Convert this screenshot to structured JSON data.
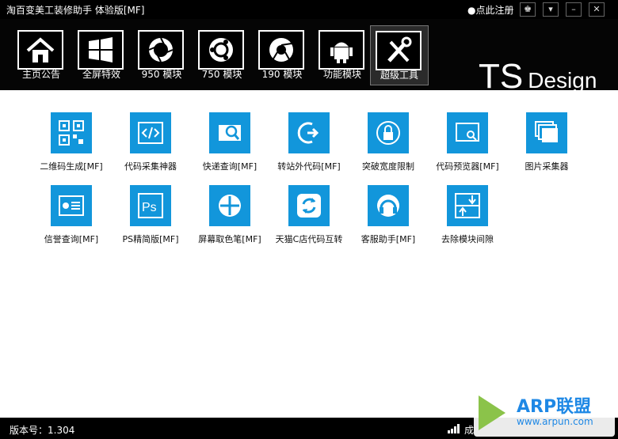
{
  "window": {
    "title": "淘百变美工装修助手  体验版[MF]",
    "register_label": "●点此注册"
  },
  "toolbar": {
    "items": [
      {
        "label": "主页公告",
        "icon": "home-icon"
      },
      {
        "label": "全屏特效",
        "icon": "windows-icon"
      },
      {
        "label": "950 模块",
        "icon": "aperture-icon"
      },
      {
        "label": "750 模块",
        "icon": "ubuntu-icon"
      },
      {
        "label": "190 模块",
        "icon": "chrome-icon"
      },
      {
        "label": "功能模块",
        "icon": "android-icon"
      },
      {
        "label": "超级工具",
        "icon": "tools-icon",
        "active": true
      }
    ]
  },
  "brand": {
    "ts": "TS",
    "design": "Design"
  },
  "tools": [
    {
      "label": "二维码生成[MF]",
      "icon": "qr-code-icon"
    },
    {
      "label": "代码采集神器",
      "icon": "code-icon"
    },
    {
      "label": "快递查询[MF]",
      "icon": "parcel-search-icon"
    },
    {
      "label": "转站外代码[MF]",
      "icon": "redirect-icon"
    },
    {
      "label": "突破宽度限制",
      "icon": "lock-icon"
    },
    {
      "label": "代码预览器[MF]",
      "icon": "preview-icon"
    },
    {
      "label": "图片采集器",
      "icon": "images-icon"
    },
    {
      "label": "信誉查询[MF]",
      "icon": "reputation-icon"
    },
    {
      "label": "PS精简版[MF]",
      "icon": "ps-icon"
    },
    {
      "label": "屏幕取色笔[MF]",
      "icon": "crosshair-icon"
    },
    {
      "label": "天猫C店代码互转",
      "icon": "refresh-icon"
    },
    {
      "label": "客服助手[MF]",
      "icon": "headset-icon"
    },
    {
      "label": "去除模块间隙",
      "icon": "gap-icon"
    }
  ],
  "status": {
    "version": "版本号：1.304",
    "right_text": "成"
  },
  "watermark": {
    "text": "ARP联盟",
    "url": "www.arpun.com"
  },
  "colors": {
    "accent": "#1296db",
    "bg": "#000000"
  }
}
